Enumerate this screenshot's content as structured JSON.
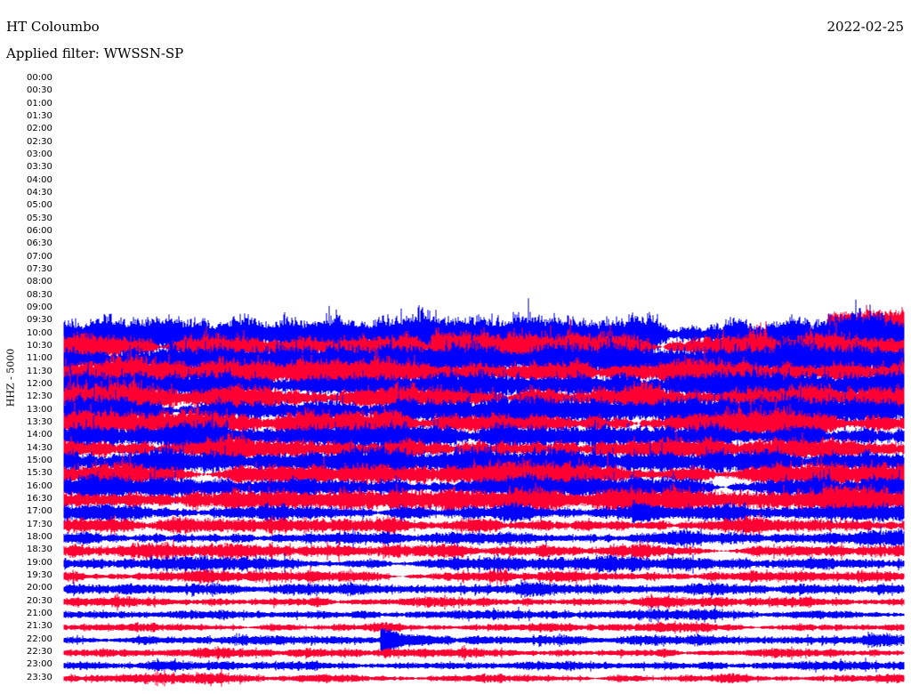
{
  "header": {
    "station": "HT Coloumbo",
    "date": "2022-02-25",
    "filter": "Applied filter: WWSSN-SP"
  },
  "chart_data": {
    "type": "line",
    "subtype": "helicorder",
    "title": "HT Coloumbo",
    "date": "2022-02-25",
    "filter": "WWSSN-SP",
    "ylabel": "HHZ - 5000",
    "row_minutes": 30,
    "colors": [
      "#0000ff",
      "#ff0033"
    ],
    "row_labels": [
      "00:00",
      "00:30",
      "01:00",
      "01:30",
      "02:00",
      "02:30",
      "03:00",
      "03:30",
      "04:00",
      "04:30",
      "05:00",
      "05:30",
      "06:00",
      "06:30",
      "07:00",
      "07:30",
      "08:00",
      "08:30",
      "09:00",
      "09:30",
      "10:00",
      "10:30",
      "11:00",
      "11:30",
      "12:00",
      "12:30",
      "13:00",
      "13:30",
      "14:00",
      "14:30",
      "15:00",
      "15:30",
      "16:00",
      "16:30",
      "17:00",
      "17:30",
      "18:00",
      "18:30",
      "19:00",
      "19:30",
      "20:00",
      "20:30",
      "21:00",
      "21:30",
      "22:00",
      "22:30",
      "23:00",
      "23:30"
    ],
    "data_start_row": "09:30",
    "data_start_fraction_in_first_row": 0.91,
    "row_relative_amplitude": {
      "09:30": 10,
      "10:00": 15,
      "10:30": 14,
      "11:00": 14,
      "11:30": 13,
      "12:00": 13,
      "12:30": 13,
      "13:00": 13,
      "13:30": 13,
      "14:00": 11,
      "14:30": 11,
      "15:00": 11,
      "15:30": 11,
      "16:00": 10,
      "16:30": 10,
      "17:00": 8,
      "17:30": 7,
      "18:00": 6,
      "18:30": 6,
      "19:00": 6,
      "19:30": 5,
      "20:00": 4.5,
      "20:30": 4.5,
      "21:00": 4,
      "21:30": 4,
      "22:00": 4,
      "22:30": 4,
      "23:00": 4,
      "23:30": 4
    },
    "events": [
      {
        "row": "22:00",
        "minute": 11.5,
        "duration_min": 1.2,
        "relative_amplitude": 12
      },
      {
        "row": "16:30",
        "minute": 27.3,
        "duration_min": 1.0,
        "relative_amplitude": 8
      },
      {
        "row": "17:00",
        "minute": 20.5,
        "duration_min": 1.0,
        "relative_amplitude": 7
      },
      {
        "row": "10:30",
        "minute": 13.3,
        "duration_min": 0.8,
        "relative_amplitude": 10
      }
    ]
  }
}
